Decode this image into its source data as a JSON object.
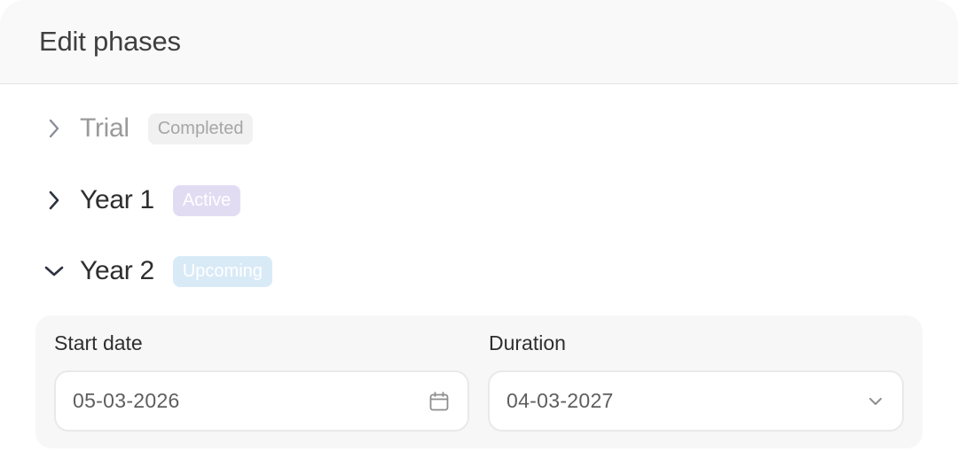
{
  "header": {
    "title": "Edit phases"
  },
  "phases": [
    {
      "name": "Trial",
      "status": "Completed",
      "expanded": false,
      "chevron": "chevron-right-icon"
    },
    {
      "name": "Year 1",
      "status": "Active",
      "expanded": false,
      "chevron": "chevron-right-icon"
    },
    {
      "name": "Year 2",
      "status": "Upcoming",
      "expanded": true,
      "chevron": "chevron-down-icon"
    }
  ],
  "details": {
    "start_date": {
      "label": "Start date",
      "value": "05-03-2026",
      "icon": "calendar-icon"
    },
    "duration": {
      "label": "Duration",
      "value": "04-03-2027",
      "icon": "chevron-down-icon"
    }
  },
  "colors": {
    "completed_badge": "#f1f1f1",
    "active_badge": "#e2dcf3",
    "upcoming_badge": "#d9eaf7"
  }
}
